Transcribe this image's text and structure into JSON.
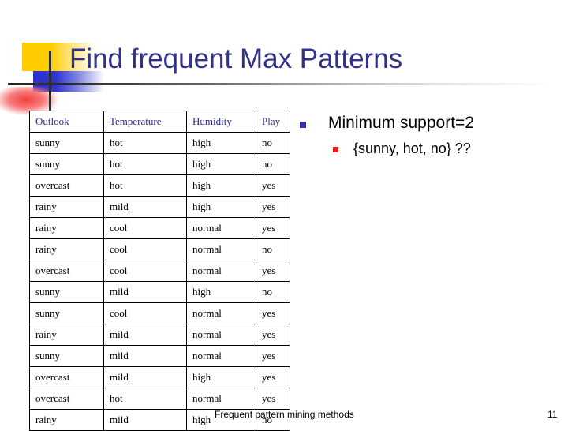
{
  "slide": {
    "title": "Find frequent Max Patterns"
  },
  "table": {
    "headers": [
      "Outlook",
      "Temperature",
      "Humidity",
      "Play"
    ],
    "rows": [
      [
        "sunny",
        "hot",
        "high",
        "no"
      ],
      [
        "sunny",
        "hot",
        "high",
        "no"
      ],
      [
        "overcast",
        "hot",
        "high",
        "yes"
      ],
      [
        "rainy",
        "mild",
        "high",
        "yes"
      ],
      [
        "rainy",
        "cool",
        "normal",
        "yes"
      ],
      [
        "rainy",
        "cool",
        "normal",
        "no"
      ],
      [
        "overcast",
        "cool",
        "normal",
        "yes"
      ],
      [
        "sunny",
        "mild",
        "high",
        "no"
      ],
      [
        "sunny",
        "cool",
        "normal",
        "yes"
      ],
      [
        "rainy",
        "mild",
        "normal",
        "yes"
      ],
      [
        "sunny",
        "mild",
        "normal",
        "yes"
      ],
      [
        "overcast",
        "mild",
        "high",
        "yes"
      ],
      [
        "overcast",
        "hot",
        "normal",
        "yes"
      ],
      [
        "rainy",
        "mild",
        "high",
        "no"
      ]
    ]
  },
  "bullets": {
    "level1": "Minimum support=2",
    "level2": "{sunny, hot, no} ??"
  },
  "footer": {
    "text": "Frequent pattern mining methods",
    "page": "11"
  },
  "colors": {
    "title": "#32328C",
    "header_text": "#2B2B8C",
    "bullet1_marker": "#3333AA",
    "bullet2_marker": "#DD2222",
    "deco_yellow": "#FFCC00",
    "deco_blue": "#2D33CC",
    "deco_red": "#F04040",
    "rule": "#2B2B2B"
  }
}
